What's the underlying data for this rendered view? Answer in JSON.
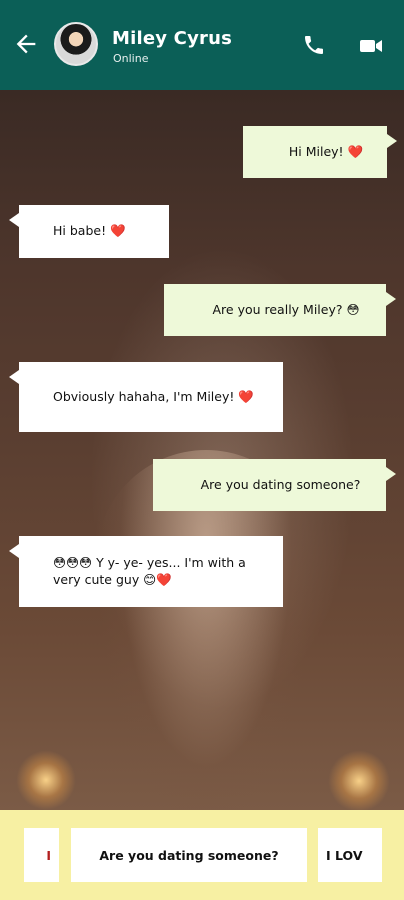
{
  "header": {
    "name": "Miley Cyrus",
    "status": "Online"
  },
  "messages": [
    {
      "text": "Hi Miley! ❤️",
      "side": "out"
    },
    {
      "text": "Hi babe! ❤️",
      "side": "in"
    },
    {
      "text": "Are you really Miley? 😳",
      "side": "out"
    },
    {
      "text": "Obviously hahaha, I'm Miley! ❤️",
      "side": "in"
    },
    {
      "text": "Are you dating someone?",
      "side": "out"
    },
    {
      "text": "😳😳😳 Y y- ye- yes... I'm with a very cute guy 😊❤️",
      "side": "in"
    }
  ],
  "suggestions": [
    {
      "text": "I"
    },
    {
      "text": "Are you dating someone?"
    },
    {
      "text": "I LOV"
    }
  ],
  "colors": {
    "header": "#0b5f57",
    "outgoing_bubble": "#eef9d9",
    "incoming_bubble": "#ffffff",
    "suggestion_bar": "#f7f0a3"
  },
  "icons": [
    "arrow-left-icon",
    "phone-icon",
    "video-camera-icon"
  ]
}
